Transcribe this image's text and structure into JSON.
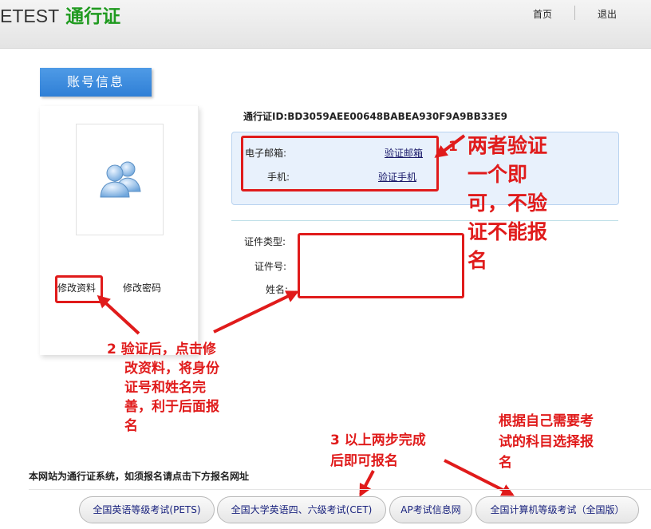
{
  "header": {
    "logo_brand": "ETEST",
    "logo_cn": "通行证",
    "nav_home": "首页",
    "nav_logout": "退出"
  },
  "tab": {
    "label": "账号信息"
  },
  "sidebar": {
    "avatar_icon": "users-icon",
    "edit_profile": "修改资料",
    "change_password": "修改密码"
  },
  "account": {
    "passport_id": "通行证ID:BD3059AEE00648BABEA930F9A9BB33E9",
    "email_label": "电子邮箱:",
    "email_action": "验证邮箱",
    "phone_label": "手机:",
    "phone_action": "验证手机",
    "id_type_label": "证件类型:",
    "id_number_label": "证件号:",
    "name_label": "姓名:"
  },
  "annotations": {
    "n1_num": "1",
    "n1_lines": [
      "两者验证",
      "一个即",
      "可，不验",
      "证不能报",
      "名"
    ],
    "n2_lines": [
      "2  验证后，点击修",
      "改资料，将身份",
      "证号和姓名完",
      "善，利于后面报",
      "名"
    ],
    "n3_lines": [
      "3 以上两步完成",
      "后即可报名"
    ],
    "n4_lines": [
      "根据自己需要考",
      "试的科目选择报",
      "名"
    ]
  },
  "footer": {
    "note": "本网站为通行证系统，如须报名请点击下方报名网址",
    "links": [
      "全国英语等级考试(PETS)",
      "全国大学英语四、六级考试(CET)",
      "AP考试信息网",
      "全国计算机等级考试（全国版）"
    ]
  },
  "colors": {
    "annotation_red": "#e01b1b",
    "brand_green": "#1f9a1f",
    "tab_blue": "#2f7fd6",
    "verify_bg": "#e8f1fc"
  }
}
